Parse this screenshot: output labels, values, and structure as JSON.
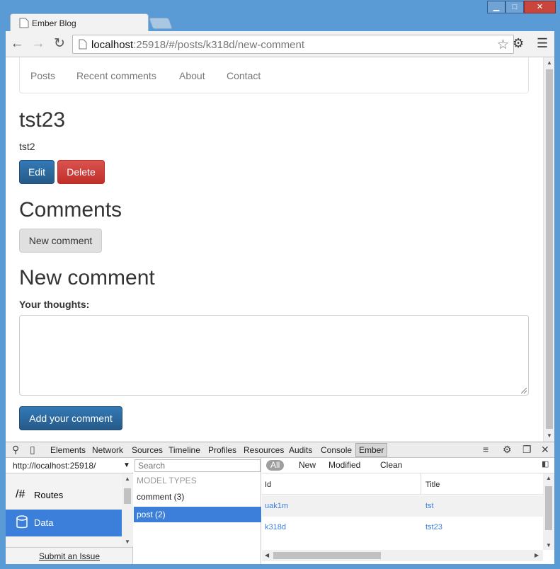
{
  "browser": {
    "tab_title": "Ember Blog",
    "address_host": "localhost",
    "address_rest": ":25918/#/posts/k318d/new-comment",
    "icons": {
      "back": "back-arrow-icon",
      "forward": "forward-arrow-icon",
      "reload": "reload-icon",
      "star": "star-icon",
      "settings": "gear-icon",
      "menu": "hamburger-menu-icon"
    }
  },
  "nav": {
    "links": [
      "Posts",
      "Recent comments",
      "About",
      "Contact"
    ]
  },
  "post": {
    "title": "tst23",
    "body": "tst2",
    "edit_label": "Edit",
    "delete_label": "Delete"
  },
  "comments": {
    "heading": "Comments",
    "new_comment_label": "New comment"
  },
  "new_comment": {
    "heading": "New comment",
    "field_label": "Your thoughts:",
    "submit_label": "Add your comment"
  },
  "devtools": {
    "tabs": [
      "Elements",
      "Network",
      "Sources",
      "Timeline",
      "Profiles",
      "Resources",
      "Audits",
      "Console",
      "Ember"
    ],
    "active_tab": "Ember",
    "app_url": "http://localhost:25918/",
    "sidebar": [
      {
        "label": "Routes",
        "icon": "routes-icon"
      },
      {
        "label": "Data",
        "icon": "database-icon"
      }
    ],
    "submit_issue": "Submit an Issue",
    "search_placeholder": "Search",
    "model_types_header": "MODEL TYPES",
    "model_types": [
      "comment (3)",
      "post (2)"
    ],
    "filters": [
      "All",
      "New",
      "Modified",
      "Clean"
    ],
    "columns": [
      "Id",
      "Title"
    ],
    "records": [
      {
        "id": "uak1m",
        "title": "tst"
      },
      {
        "id": "k318d",
        "title": "tst23"
      }
    ]
  },
  "colors": {
    "chrome_frame": "#5b9bd5",
    "primary": "#337ab7",
    "danger": "#d9534f",
    "devtools_active": "#3b7fdb"
  }
}
